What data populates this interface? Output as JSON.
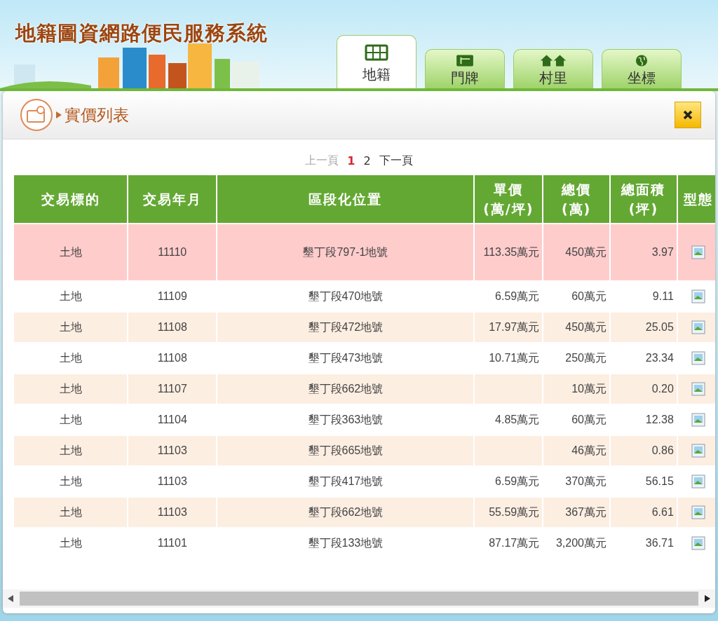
{
  "header": {
    "title": "地籍圖資網路便民服務系統"
  },
  "tabs": [
    {
      "label": "地籍",
      "kind": "map",
      "selected": true
    },
    {
      "label": "門牌",
      "kind": "plate",
      "selected": false
    },
    {
      "label": "村里",
      "kind": "houses",
      "selected": false
    },
    {
      "label": "坐標",
      "kind": "globe",
      "selected": false
    }
  ],
  "dialog": {
    "title": "實價列表"
  },
  "pagination": {
    "prev": {
      "label": "上一頁",
      "disabled": true
    },
    "pages": [
      {
        "label": "1",
        "selected": true
      },
      {
        "label": "2",
        "selected": false
      }
    ],
    "next": {
      "label": "下一頁",
      "disabled": false
    }
  },
  "table": {
    "columns": [
      {
        "lines": [
          "交易標的"
        ]
      },
      {
        "lines": [
          "交易年月"
        ]
      },
      {
        "lines": [
          "區段化位置"
        ]
      },
      {
        "lines": [
          "單價",
          "(萬/坪)"
        ]
      },
      {
        "lines": [
          "總價",
          "(萬)"
        ]
      },
      {
        "lines": [
          "總面積",
          "(坪)"
        ]
      },
      {
        "lines": [
          "型態"
        ]
      }
    ],
    "rows": [
      {
        "highlighted": true,
        "cells": [
          "土地",
          "11110",
          "墾丁段797-1地號",
          "113.35萬元",
          "450萬元",
          "3.97"
        ]
      },
      {
        "highlighted": false,
        "cells": [
          "土地",
          "11109",
          "墾丁段470地號",
          "6.59萬元",
          "60萬元",
          "9.11"
        ]
      },
      {
        "highlighted": false,
        "cells": [
          "土地",
          "11108",
          "墾丁段472地號",
          "17.97萬元",
          "450萬元",
          "25.05"
        ]
      },
      {
        "highlighted": false,
        "cells": [
          "土地",
          "11108",
          "墾丁段473地號",
          "10.71萬元",
          "250萬元",
          "23.34"
        ]
      },
      {
        "highlighted": false,
        "cells": [
          "土地",
          "11107",
          "墾丁段662地號",
          "",
          "10萬元",
          "0.20"
        ]
      },
      {
        "highlighted": false,
        "cells": [
          "土地",
          "11104",
          "墾丁段363地號",
          "4.85萬元",
          "60萬元",
          "12.38"
        ]
      },
      {
        "highlighted": false,
        "cells": [
          "土地",
          "11103",
          "墾丁段665地號",
          "",
          "46萬元",
          "0.86"
        ]
      },
      {
        "highlighted": false,
        "cells": [
          "土地",
          "11103",
          "墾丁段417地號",
          "6.59萬元",
          "370萬元",
          "56.15"
        ]
      },
      {
        "highlighted": false,
        "cells": [
          "土地",
          "11103",
          "墾丁段662地號",
          "55.59萬元",
          "367萬元",
          "6.61"
        ]
      },
      {
        "highlighted": false,
        "cells": [
          "土地",
          "11101",
          "墾丁段133地號",
          "87.17萬元",
          "3,200萬元",
          "36.71"
        ]
      }
    ]
  }
}
